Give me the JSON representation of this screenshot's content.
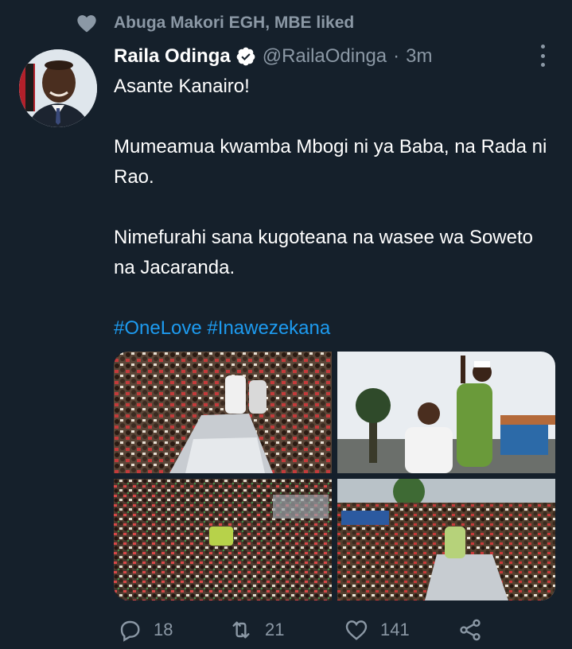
{
  "social_context": {
    "icon": "heart-icon",
    "text": "Abuga Makori EGH, MBE liked"
  },
  "author": {
    "display_name": "Raila Odinga",
    "verified": true,
    "handle": "@RailaOdinga",
    "separator": "·",
    "timestamp": "3m"
  },
  "tweet": {
    "paragraphs": [
      "Asante Kanairo!",
      "Mumeamua kwamba Mbogi ni ya Baba, na Rada ni Rao.",
      "Nimefurahi sana kugoteana na wasee wa Soweto na Jacaranda."
    ],
    "hashtags": "#OneLove #Inawezekana"
  },
  "media": {
    "photos": [
      "crowd-car-photo",
      "rally-speakers-photo",
      "crowd-wide-photo",
      "crowd-street-photo"
    ]
  },
  "actions": {
    "reply": {
      "icon": "reply-icon",
      "count": "18"
    },
    "retweet": {
      "icon": "retweet-icon",
      "count": "21"
    },
    "like": {
      "icon": "heart-icon",
      "count": "141"
    },
    "share": {
      "icon": "share-icon"
    }
  },
  "colors": {
    "background": "#15202b",
    "text_secondary": "#8b98a5",
    "link": "#1d9bf0"
  }
}
